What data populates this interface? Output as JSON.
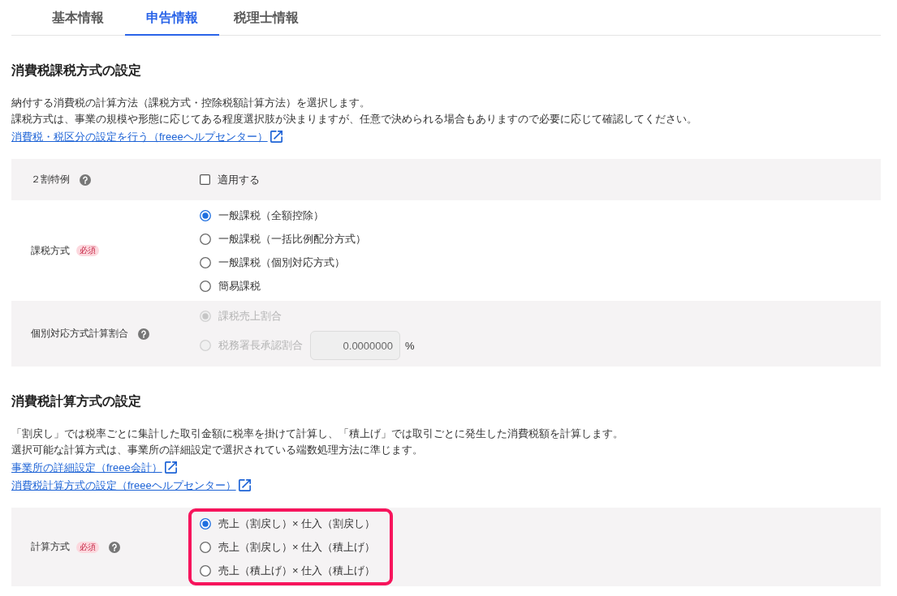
{
  "tabs": [
    {
      "label": "基本情報",
      "selected": false
    },
    {
      "label": "申告情報",
      "selected": true
    },
    {
      "label": "税理士情報",
      "selected": false
    }
  ],
  "sections": [
    {
      "title": "消費税課税方式の設定",
      "description": [
        "納付する消費税の計算方法（課税方式・控除税額計算方法）を選択します。",
        "課税方式は、事業の規模や形態に応じてある程度選択肢が決まりますが、任意で決められる場合もありますので必要に応じて確認してください。"
      ],
      "links": [
        {
          "label": "消費税・税区分の設定を行う（freeeヘルプセンター）",
          "external": true
        }
      ],
      "fields": [
        {
          "kind": "checkbox",
          "label": "２割特例",
          "help": true,
          "highlighted": false,
          "option": {
            "label": "適用する",
            "checked": false
          }
        },
        {
          "kind": "radio",
          "label": "課税方式",
          "badge": "必須",
          "help": false,
          "highlighted": false,
          "options": [
            {
              "label": "一般課税（全額控除）",
              "selected": true,
              "disabled": false
            },
            {
              "label": "一般課税（一括比例配分方式）",
              "selected": false,
              "disabled": false
            },
            {
              "label": "一般課税（個別対応方式）",
              "selected": false,
              "disabled": false
            },
            {
              "label": "簡易課税",
              "selected": false,
              "disabled": false
            }
          ]
        },
        {
          "kind": "radio",
          "label": "個別対応方式計算割合",
          "help": true,
          "highlighted": false,
          "options": [
            {
              "label": "課税売上割合",
              "selected": true,
              "disabled": true
            },
            {
              "label": "税務署長承認割合",
              "selected": false,
              "disabled": true,
              "input": {
                "value": "0.0000000",
                "unit": "%",
                "disabled": true
              }
            }
          ]
        }
      ]
    },
    {
      "title": "消費税計算方式の設定",
      "description": [
        "「割戻し」では税率ごとに集計した取引金額に税率を掛けて計算し、「積上げ」では取引ごとに発生した消費税額を計算します。",
        "選択可能な計算方式は、事業所の詳細設定で選択されている端数処理方法に準じます。"
      ],
      "links": [
        {
          "label": "事業所の詳細設定（freee会計）",
          "external": true
        },
        {
          "label": "消費税計算方式の設定（freeeヘルプセンター）",
          "external": true
        }
      ],
      "fields": [
        {
          "kind": "radio",
          "label": "計算方式",
          "badge": "必須",
          "help": true,
          "highlighted": true,
          "options": [
            {
              "label": "売上（割戻し）× 仕入（割戻し）",
              "selected": true,
              "disabled": false
            },
            {
              "label": "売上（割戻し）× 仕入（積上げ）",
              "selected": false,
              "disabled": false
            },
            {
              "label": "売上（積上げ）× 仕入（積上げ）",
              "selected": false,
              "disabled": false
            }
          ]
        }
      ]
    }
  ]
}
